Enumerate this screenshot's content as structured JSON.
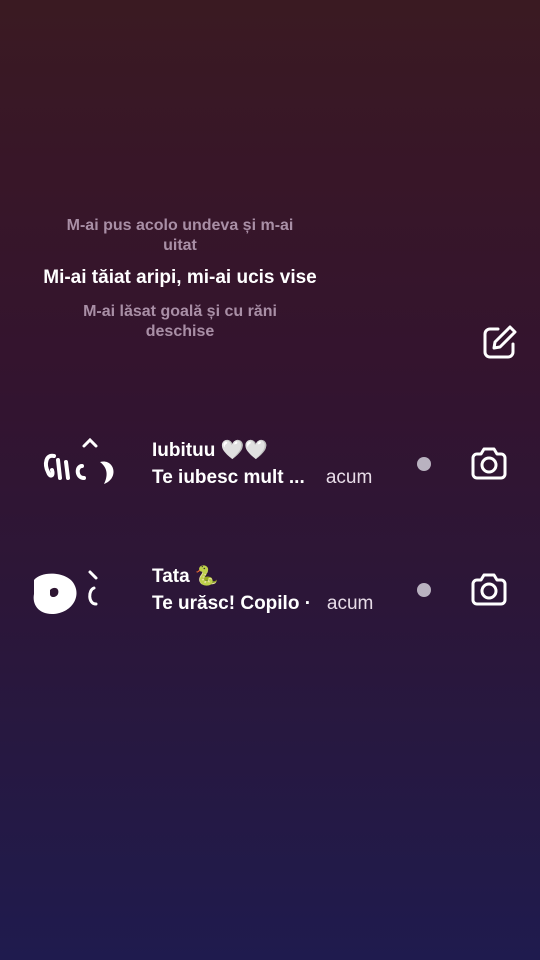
{
  "lyrics": {
    "previous": "M-ai pus acolo undeva și m-ai uitat",
    "current": "Mi-ai tăiat aripi, mi-ai ucis vise",
    "next": "M-ai lăsat goală și cu răni deschise"
  },
  "toolbar": {
    "edit_icon": "edit-square-icon"
  },
  "chats": [
    {
      "name": "Iubituu 🤍🤍",
      "preview": "Te iubesc mult ...",
      "time": "acum",
      "unread": true,
      "camera_icon": "camera-icon"
    },
    {
      "name": "Tata 🐍",
      "preview": "Te urăsc! Copilo ·",
      "time": "acum",
      "unread": true,
      "camera_icon": "camera-icon"
    }
  ],
  "colors": {
    "unread_dot": "#b9b2c0",
    "lyric_dim": "#a98fa6"
  }
}
